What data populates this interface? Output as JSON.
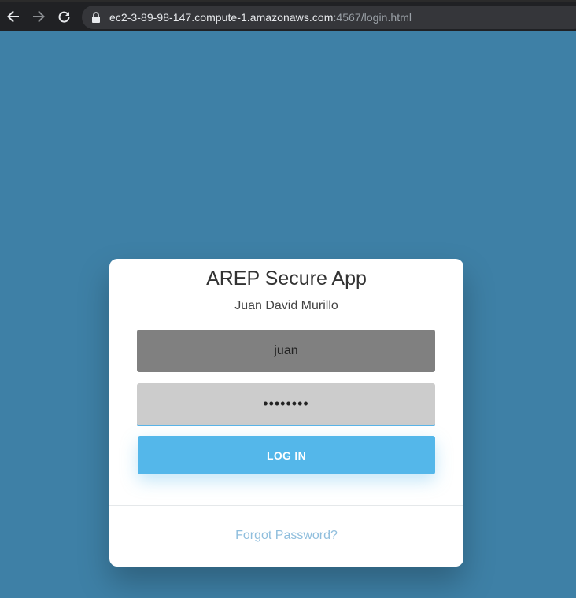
{
  "browser": {
    "url_host": "ec2-3-89-98-147.compute-1.amazonaws.com",
    "url_rest": ":4567/login.html",
    "icons": [
      "back-arrow-icon",
      "forward-arrow-icon",
      "reload-icon",
      "lock-icon"
    ]
  },
  "login": {
    "title": "AREP Secure App",
    "subtitle": "Juan David Murillo",
    "username_value": "juan",
    "password_value": "••••••••",
    "login_button": "LOG IN",
    "forgot_link": "Forgot Password?"
  },
  "colors": {
    "background": "#3e80a6",
    "button": "#54b7ea",
    "link": "#8fbedd"
  }
}
